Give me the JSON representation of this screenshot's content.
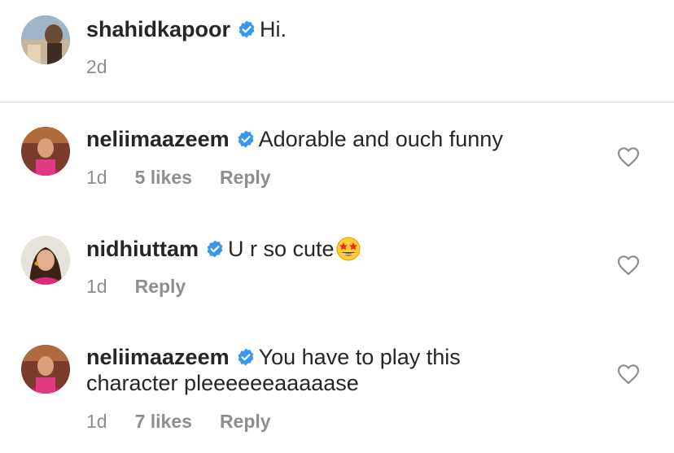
{
  "caption": {
    "username": "shahidkapoor",
    "text": "Hi.",
    "time": "2d"
  },
  "comments": [
    {
      "username": "neliimaazeem",
      "text": "Adorable and ouch funny",
      "time": "1d",
      "likes": "5 likes",
      "reply": "Reply"
    },
    {
      "username": "nidhiuttam",
      "text": "U r so cute",
      "emoji": "star-struck-emoji",
      "time": "1d",
      "reply": "Reply"
    },
    {
      "username": "neliimaazeem",
      "text": "You have to play this character pleeeeeeaaaaase",
      "time": "1d",
      "likes": "7 likes",
      "reply": "Reply"
    }
  ],
  "icons": {
    "verified": "verified-badge-icon",
    "heart": "heart-outline-icon"
  },
  "colors": {
    "verified_blue": "#3897f0",
    "secondary_text": "#8e8e8e",
    "divider": "#dbdbdb"
  }
}
